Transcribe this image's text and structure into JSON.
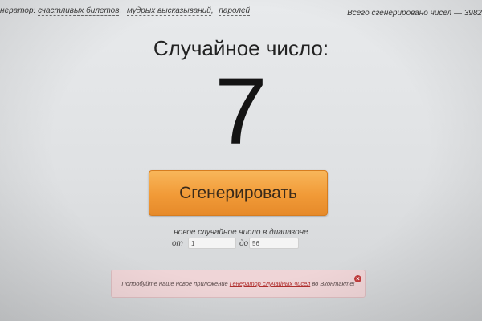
{
  "topbar": {
    "left_prefix": "нератор:",
    "links": [
      "счастливых билетов",
      "мудрых высказываний",
      "паролей"
    ],
    "total_text": "Всего сгенерировано чисел — 3982"
  },
  "main": {
    "title": "Случайное число:",
    "number": "7",
    "generate_label": "Сгенерировать",
    "range_caption": "новое случайное число в диапазоне",
    "from_label": "от",
    "from_value": "1",
    "to_label": "до",
    "to_value": "56"
  },
  "promo": {
    "text_before": "Попробуйте наше новое приложение",
    "link_text": "Генератор случайных чисел",
    "text_after": "во Вконтакте!",
    "close_glyph": "×"
  },
  "colors": {
    "button_orange": "#f19a37",
    "promo_background": "#efd5d7",
    "close_red": "#c23b3b"
  }
}
